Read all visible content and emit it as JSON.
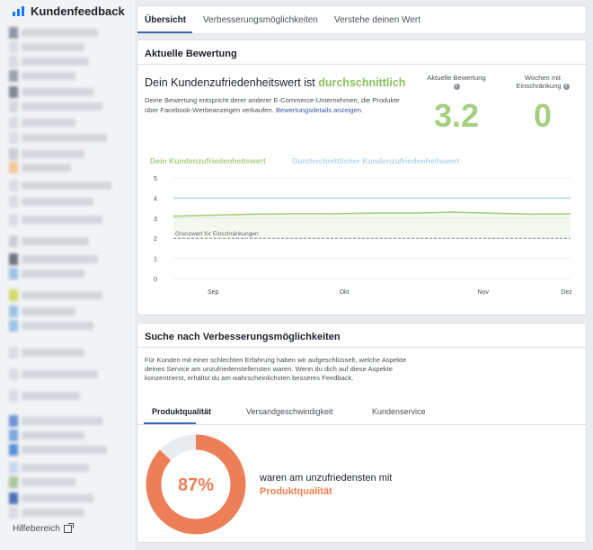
{
  "sidebar": {
    "title": "Kundenfeedback",
    "footer": "Hilfebereich"
  },
  "tabs": [
    "Übersicht",
    "Verbesserungsmöglichkeiten",
    "Verstehe deinen Wert"
  ],
  "rating": {
    "title": "Aktuelle Bewertung",
    "heading_prefix": "Dein Kundenzufriedenheitswert ist",
    "heading_value": "durchschnittlich",
    "description": "Deine Bewertung entspricht derer anderer E-Commerce-Unternehmen, die Produkte über Facebook-Werbeanzeigen verkaufen.",
    "details_link": "Bewertungsdetails anzeigen.",
    "kpi_current_label": "Aktuelle Bewertung",
    "kpi_current_value": "3.2",
    "kpi_weeks_label_1": "Wochen mit",
    "kpi_weeks_label_2": "Einschränkung",
    "kpi_weeks_value": "0",
    "info_glyph": "i",
    "legend_own": "Dein Kundenzufriedenheitswert",
    "legend_avg": "Durchschnittlicher Kundenzufriedenheitswert",
    "threshold_label": "Grenzwert für Einschränkungen"
  },
  "chart_data": {
    "type": "line",
    "title": "",
    "xlabel": "",
    "ylabel": "",
    "ylim": [
      0,
      5
    ],
    "yticks": [
      "0",
      "1",
      "2",
      "3",
      "4",
      "5"
    ],
    "x_ticks": [
      "Sep",
      "Okt",
      "Nov",
      "Dez"
    ],
    "grid": true,
    "series": [
      {
        "name": "Dein Kundenzufriedenheitswert",
        "color": "#a6cf80",
        "points": [
          [
            0.0,
            3.1
          ],
          [
            0.1,
            3.15
          ],
          [
            0.2,
            3.2
          ],
          [
            0.3,
            3.22
          ],
          [
            0.4,
            3.22
          ],
          [
            0.5,
            3.25
          ],
          [
            0.6,
            3.25
          ],
          [
            0.7,
            3.3
          ],
          [
            0.8,
            3.25
          ],
          [
            0.9,
            3.2
          ],
          [
            1.0,
            3.22
          ]
        ]
      },
      {
        "name": "Durchschnittlicher Kundenzufriedenheitswert",
        "color": "#b6d5ea",
        "points": [
          [
            0.0,
            4.0
          ],
          [
            1.0,
            4.0
          ]
        ]
      }
    ],
    "threshold": {
      "value": 2,
      "label": "Grenzwert für Einschränkungen"
    }
  },
  "improve": {
    "title": "Suche nach Verbesserungsmöglichkeiten",
    "description": "Für Kunden mit einer schlechten Erfahrung haben wir aufgeschlüsselt, welche Aspekte deines Service am unzufriedenstellensten waren. Wenn du dich auf diese Aspekte konzentrierst, erhältst du am wahrscheinlichsten besseres Feedback.",
    "sub_tabs": [
      "Produktqualität",
      "Versandgeschwindigkeit",
      "Kundenservice"
    ],
    "percent_label": "87%",
    "percent_value": 0.87,
    "result_text": "waren am unzufriedensten mit",
    "result_highlight": "Produktqualität"
  },
  "colors": {
    "accent_green": "#a6cf80",
    "accent_blue": "#b6d5ea",
    "donut_orange": "#ec7f57",
    "donut_grey": "#e9ebee",
    "tab_blue": "#4267b2"
  }
}
